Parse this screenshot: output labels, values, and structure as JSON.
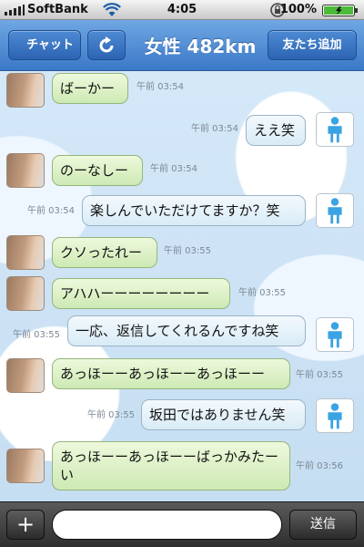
{
  "status_bar": {
    "carrier": "SoftBank",
    "time": "4:05",
    "battery": "100%"
  },
  "nav": {
    "back_label": "チャット",
    "title": "女性 482km",
    "add_friend_label": "友たち追加"
  },
  "messages": [
    {
      "side": "in",
      "text": "ばーかー",
      "time": "午前 03:54"
    },
    {
      "side": "out",
      "text": "ええ笑",
      "time": "午前 03:54"
    },
    {
      "side": "in",
      "text": "のーなしー",
      "time": "午前 03:54"
    },
    {
      "side": "out",
      "text": "楽しんでいただけてますか？笑",
      "time": "午前 03:54"
    },
    {
      "side": "in",
      "text": "クソったれー",
      "time": "午前 03:55"
    },
    {
      "side": "in",
      "text": "アハハーーーーーーーー",
      "time": "午前 03:55"
    },
    {
      "side": "out",
      "text": "一応、返信してくれるんですね笑",
      "time": "午前 03:55"
    },
    {
      "side": "in",
      "text": "あっほーーあっほーーあっほーー",
      "time": "午前 03:55"
    },
    {
      "side": "out",
      "text": "坂田ではありません笑",
      "time": "午前 03:55"
    },
    {
      "side": "in",
      "text": "あっほーーあっほーーばっかみたーい",
      "time": "午前 03:56"
    }
  ],
  "input": {
    "plus_label": "+",
    "placeholder": "",
    "send_label": "送信"
  },
  "icons": {
    "refresh": "refresh-icon",
    "user": "user-silhouette-icon",
    "wifi": "wifi-icon",
    "lock": "rotation-lock-icon",
    "battery": "battery-icon"
  },
  "colors": {
    "nav": "#3b78c7",
    "incoming_bubble": "#cde9b4",
    "outgoing_bubble": "#d9ebf6",
    "user_icon": "#3aa3e3"
  }
}
